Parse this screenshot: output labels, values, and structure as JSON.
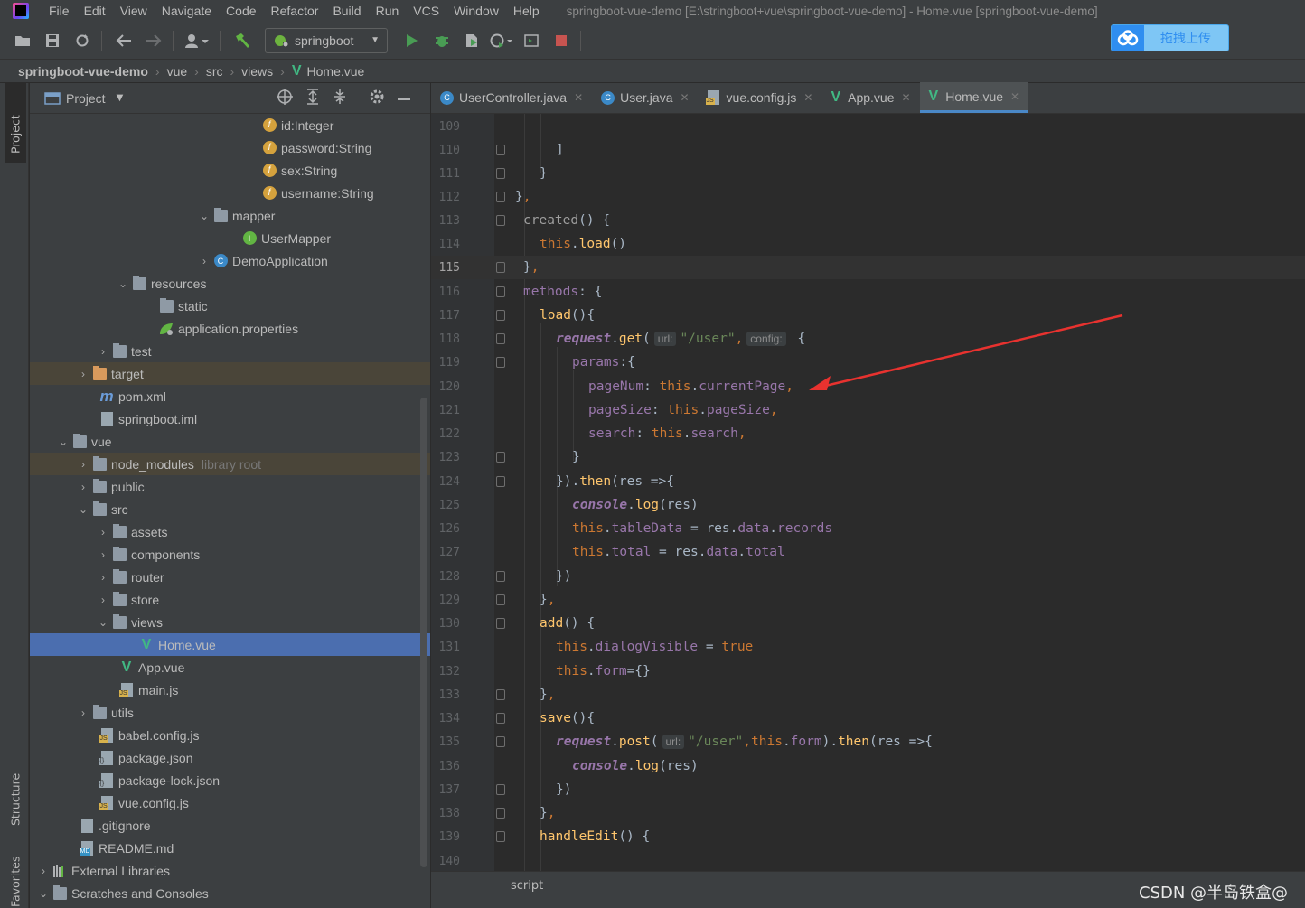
{
  "window_title": "springboot-vue-demo [E:\\stringboot+vue\\springboot-vue-demo] - Home.vue [springboot-vue-demo]",
  "menu": [
    "File",
    "Edit",
    "View",
    "Navigate",
    "Code",
    "Refactor",
    "Build",
    "Run",
    "VCS",
    "Window",
    "Help"
  ],
  "toolbar": {
    "run_config": "springboot",
    "upload_label": "拖拽上传"
  },
  "breadcrumb": [
    "springboot-vue-demo",
    "vue",
    "src",
    "views",
    "Home.vue"
  ],
  "side_tabs": {
    "project": "Project",
    "structure": "Structure",
    "favorites": "Favorites"
  },
  "project_panel": {
    "title": "Project"
  },
  "tree": [
    {
      "label": "id:Integer",
      "icon": "field-icon"
    },
    {
      "label": "password:String",
      "icon": "field-icon"
    },
    {
      "label": "sex:String",
      "icon": "field-icon"
    },
    {
      "label": "username:String",
      "icon": "field-icon"
    },
    {
      "label": "mapper",
      "icon": "package-icon"
    },
    {
      "label": "UserMapper",
      "icon": "interface-icon"
    },
    {
      "label": "DemoApplication",
      "icon": "springboot-app-icon"
    },
    {
      "label": "resources",
      "icon": "folder-icon"
    },
    {
      "label": "static",
      "icon": "folder-icon"
    },
    {
      "label": "application.properties",
      "icon": "properties-icon"
    },
    {
      "label": "test",
      "icon": "folder-icon"
    },
    {
      "label": "target",
      "icon": "folder-excluded-icon"
    },
    {
      "label": "pom.xml",
      "icon": "maven-icon"
    },
    {
      "label": "springboot.iml",
      "icon": "file-icon"
    },
    {
      "label": "vue",
      "icon": "folder-icon"
    },
    {
      "label": "node_modules",
      "extra": "library root",
      "icon": "folder-icon"
    },
    {
      "label": "public",
      "icon": "folder-icon"
    },
    {
      "label": "src",
      "icon": "folder-icon"
    },
    {
      "label": "assets",
      "icon": "folder-icon"
    },
    {
      "label": "components",
      "icon": "folder-icon"
    },
    {
      "label": "router",
      "icon": "folder-icon"
    },
    {
      "label": "store",
      "icon": "folder-icon"
    },
    {
      "label": "views",
      "icon": "folder-icon"
    },
    {
      "label": "Home.vue",
      "icon": "vue-icon"
    },
    {
      "label": "App.vue",
      "icon": "vue-icon"
    },
    {
      "label": "main.js",
      "icon": "js-file-icon"
    },
    {
      "label": "utils",
      "icon": "folder-icon"
    },
    {
      "label": "babel.config.js",
      "icon": "js-file-icon"
    },
    {
      "label": "package.json",
      "icon": "json-file-icon"
    },
    {
      "label": "package-lock.json",
      "icon": "json-file-icon"
    },
    {
      "label": "vue.config.js",
      "icon": "js-file-icon"
    },
    {
      "label": ".gitignore",
      "icon": "file-icon"
    },
    {
      "label": "README.md",
      "icon": "markdown-icon"
    },
    {
      "label": "External Libraries",
      "icon": "libraries-icon"
    },
    {
      "label": "Scratches and Consoles",
      "icon": "scratches-icon"
    }
  ],
  "editor_tabs": [
    {
      "label": "UserController.java",
      "icon": "class-icon"
    },
    {
      "label": "User.java",
      "icon": "class-icon"
    },
    {
      "label": "vue.config.js",
      "icon": "js-file-icon"
    },
    {
      "label": "App.vue",
      "icon": "vue-icon"
    },
    {
      "label": "Home.vue",
      "icon": "vue-icon",
      "active": true
    }
  ],
  "code_lines": {
    "numbers": [
      "109",
      "110",
      "111",
      "112",
      "113",
      "114",
      "115",
      "116",
      "117",
      "118",
      "119",
      "120",
      "121",
      "122",
      "123",
      "124",
      "125",
      "126",
      "127",
      "128",
      "129",
      "130",
      "131",
      "132",
      "133",
      "134",
      "135",
      "136",
      "137",
      "138",
      "139",
      "140"
    ],
    "current_line": "115",
    "hints": {
      "url": "url:",
      "config": "config:"
    },
    "t": {
      "close_bracket": "]",
      "close_brace": "}",
      "close_brace_comma": "},",
      "created": "created",
      "paren_brace": "() {",
      "this": "this",
      "load": "load",
      "parens": "()",
      "methods": "methods",
      "colon_brace": ": {",
      "load_open": "(){",
      "request": "request",
      "get": "get",
      "open_paren": "(",
      "url_user": "\"/user\"",
      "comma": ",",
      "space_brace": " {",
      "params": "params",
      "colon_open": ":{",
      "pageNum": "pageNum",
      "colon_sp": ": ",
      "currentPage": "currentPage",
      "pageSize": "pageSize",
      "search": "search",
      "then_close": "}).",
      "then": "then",
      "res_arrow": "(res =>{",
      "console": "console",
      "log": "log",
      "paren_res": "(res)",
      "tableData": "tableData",
      "eq": " = ",
      "res_data": "res.",
      "data": "data",
      "records": "records",
      "total": "total",
      "close_paren_brace": "})",
      "add": "add",
      "dialogVisible": "dialogVisible",
      "true": "true",
      "form": "form",
      "eq_obj": "={}",
      "save": "save",
      "post": "post",
      "close_paren_dot": ").",
      "handleEdit": "handleEdit",
      "dot": "."
    }
  },
  "status": {
    "script": "script"
  },
  "watermark": "CSDN @半岛铁盒@"
}
